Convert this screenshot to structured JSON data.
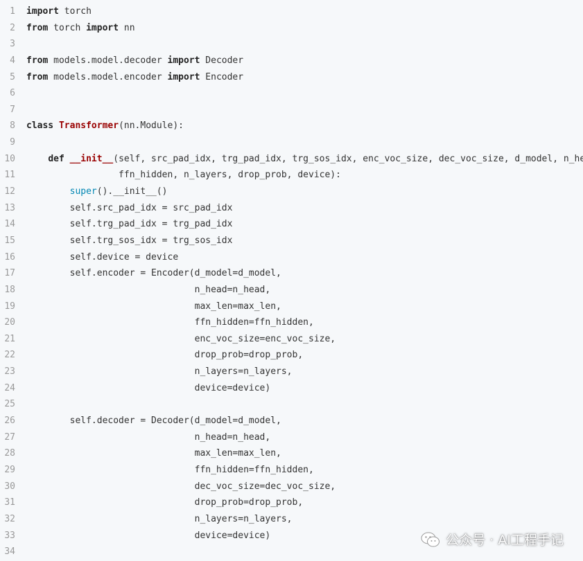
{
  "code": {
    "lines": [
      [
        [
          "kw",
          "import"
        ],
        [
          "p",
          " torch"
        ]
      ],
      [
        [
          "kw",
          "from"
        ],
        [
          "p",
          " torch "
        ],
        [
          "kw",
          "import"
        ],
        [
          "p",
          " nn"
        ]
      ],
      [],
      [
        [
          "kw",
          "from"
        ],
        [
          "p",
          " models.model.decoder "
        ],
        [
          "kw",
          "import"
        ],
        [
          "p",
          " Decoder"
        ]
      ],
      [
        [
          "kw",
          "from"
        ],
        [
          "p",
          " models.model.encoder "
        ],
        [
          "kw",
          "import"
        ],
        [
          "p",
          " Encoder"
        ]
      ],
      [],
      [],
      [
        [
          "kw",
          "class"
        ],
        [
          "p",
          " "
        ],
        [
          "cls",
          "Transformer"
        ],
        [
          "p",
          "(nn.Module):"
        ]
      ],
      [],
      [
        [
          "p",
          "    "
        ],
        [
          "kw",
          "def"
        ],
        [
          "p",
          " "
        ],
        [
          "fn",
          "__init__"
        ],
        [
          "p",
          "(self, src_pad_idx, trg_pad_idx, trg_sos_idx, enc_voc_size, dec_voc_size, d_model, n_head, ma"
        ]
      ],
      [
        [
          "p",
          "                 ffn_hidden, n_layers, drop_prob, device):"
        ]
      ],
      [
        [
          "p",
          "        "
        ],
        [
          "bi",
          "super"
        ],
        [
          "p",
          "().__init__()"
        ]
      ],
      [
        [
          "p",
          "        self.src_pad_idx = src_pad_idx"
        ]
      ],
      [
        [
          "p",
          "        self.trg_pad_idx = trg_pad_idx"
        ]
      ],
      [
        [
          "p",
          "        self.trg_sos_idx = trg_sos_idx"
        ]
      ],
      [
        [
          "p",
          "        self.device = device"
        ]
      ],
      [
        [
          "p",
          "        self.encoder = Encoder(d_model=d_model,"
        ]
      ],
      [
        [
          "p",
          "                               n_head=n_head,"
        ]
      ],
      [
        [
          "p",
          "                               max_len=max_len,"
        ]
      ],
      [
        [
          "p",
          "                               ffn_hidden=ffn_hidden,"
        ]
      ],
      [
        [
          "p",
          "                               enc_voc_size=enc_voc_size,"
        ]
      ],
      [
        [
          "p",
          "                               drop_prob=drop_prob,"
        ]
      ],
      [
        [
          "p",
          "                               n_layers=n_layers,"
        ]
      ],
      [
        [
          "p",
          "                               device=device)"
        ]
      ],
      [],
      [
        [
          "p",
          "        self.decoder = Decoder(d_model=d_model,"
        ]
      ],
      [
        [
          "p",
          "                               n_head=n_head,"
        ]
      ],
      [
        [
          "p",
          "                               max_len=max_len,"
        ]
      ],
      [
        [
          "p",
          "                               ffn_hidden=ffn_hidden,"
        ]
      ],
      [
        [
          "p",
          "                               dec_voc_size=dec_voc_size,"
        ]
      ],
      [
        [
          "p",
          "                               drop_prob=drop_prob,"
        ]
      ],
      [
        [
          "p",
          "                               n_layers=n_layers,"
        ]
      ],
      [
        [
          "p",
          "                               device=device)"
        ]
      ],
      []
    ]
  },
  "watermark": {
    "icon": "wechat-icon",
    "text": "公众号 · AI工程手记"
  },
  "colors": {
    "background": "#f6f8fa",
    "text": "#333333",
    "line_number": "#999999",
    "class_name": "#990000",
    "builtin": "#0086b3"
  }
}
